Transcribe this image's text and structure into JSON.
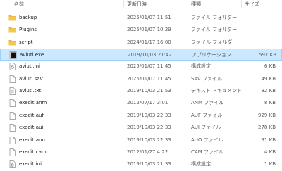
{
  "header": {
    "name": "名前",
    "date": "更新日時",
    "type": "種類",
    "size": "サイズ"
  },
  "files": [
    {
      "name": "backup",
      "date": "2025/01/07 11:51",
      "type": "ファイル フォルダー",
      "size": "",
      "icon": "folder-icon"
    },
    {
      "name": "Plugins",
      "date": "2025/01/07 10:29",
      "type": "ファイル フォルダー",
      "size": "",
      "icon": "folder-icon"
    },
    {
      "name": "script",
      "date": "2024/01/17 16:00",
      "type": "ファイル フォルダー",
      "size": "",
      "icon": "folder-icon"
    },
    {
      "name": "aviutl.exe",
      "date": "2019/10/03 21:42",
      "type": "アプリケーション",
      "size": "597 KB",
      "icon": "application-icon"
    },
    {
      "name": "aviutl.ini",
      "date": "2025/01/07 11:45",
      "type": "構成設定",
      "size": "6 KB",
      "icon": "settings-file-icon"
    },
    {
      "name": "aviutl.sav",
      "date": "2025/01/07 11:45",
      "type": "SAV ファイル",
      "size": "49 KB",
      "icon": "file-icon"
    },
    {
      "name": "aviutl.txt",
      "date": "2019/10/03 21:53",
      "type": "テキスト ドキュメント",
      "size": "82 KB",
      "icon": "text-file-icon"
    },
    {
      "name": "exedit.anm",
      "date": "2012/07/17 3:01",
      "type": "ANM ファイル",
      "size": "8 KB",
      "icon": "file-icon"
    },
    {
      "name": "exedit.auf",
      "date": "2019/10/03 22:33",
      "type": "AUF ファイル",
      "size": "929 KB",
      "icon": "file-icon"
    },
    {
      "name": "exedit.aui",
      "date": "2019/10/03 22:33",
      "type": "AUI ファイル",
      "size": "278 KB",
      "icon": "file-icon"
    },
    {
      "name": "exedit.auo",
      "date": "2019/10/03 22:33",
      "type": "AUO ファイル",
      "size": "91 KB",
      "icon": "file-icon"
    },
    {
      "name": "exedit.cam",
      "date": "2012/01/27 4:22",
      "type": "CAM ファイル",
      "size": "4 KB",
      "icon": "file-icon"
    },
    {
      "name": "exedit.ini",
      "date": "2019/10/03 21:33",
      "type": "構成設定",
      "size": "1 KB",
      "icon": "settings-file-icon"
    }
  ],
  "selected_index": 3,
  "colors": {
    "selection_bg": "#cce8ff",
    "selection_border": "#99d1ff",
    "folder": "#f5c147"
  }
}
